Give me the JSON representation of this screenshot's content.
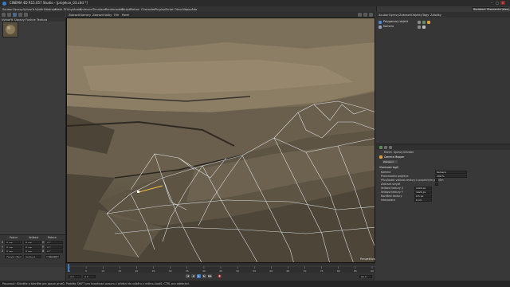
{
  "window": {
    "title": "CINEMA 4D R15.057 Studio - [projekce_03.c4d *]",
    "minimize": "–",
    "maximize": "□",
    "close": "×"
  },
  "menubar": {
    "items": [
      "Soubor",
      "Úpravy",
      "Vytvořit",
      "Výběr",
      "Nástroje",
      "Mesh",
      "Přichytávání",
      "Animace",
      "Simulace",
      "Renderování",
      "Skulpt",
      "Motion",
      "Character",
      "Pluginy",
      "Skript",
      "Okno",
      "Nápověda"
    ]
  },
  "layout": {
    "label_prefix": "Rozložení:",
    "value": "Standardní (start)"
  },
  "material_manager": {
    "tabs": [
      "Vytvořit",
      "Úpravy",
      "Funkce",
      "Textura"
    ]
  },
  "viewport_menu": [
    "Zobrazit",
    "Kamery",
    "Zobrazit",
    "Volby",
    "Filtr",
    "Panel"
  ],
  "viewport": {
    "frame_label": "Perspektiva"
  },
  "coordinates": {
    "headers": [
      "Pozice",
      "Velikost",
      "Rotace"
    ],
    "rows": [
      {
        "axis": "X",
        "pos": "0 cm",
        "size": "0 cm",
        "rot_label": "H",
        "rot": "0 °"
      },
      {
        "axis": "Y",
        "pos": "0 cm",
        "size": "0 cm",
        "rot_label": "P",
        "rot": "0 °"
      },
      {
        "axis": "Z",
        "pos": "0 cm",
        "size": "0 cm",
        "rot_label": "B",
        "rot": "0 °"
      }
    ],
    "mode": "Objekt (Rel)",
    "size_mode": "Velikost",
    "apply": "Použít"
  },
  "object_manager": {
    "menu": [
      "Soubor",
      "Úpravy",
      "Zobrazit",
      "Objekty",
      "Tagy",
      "Záložky"
    ],
    "objects": [
      {
        "name": "Polygonový objekt"
      },
      {
        "name": "Kamera"
      }
    ]
  },
  "attribute_manager": {
    "menu": [
      "Režim",
      "Úpravy",
      "Uživatel"
    ],
    "section_title": "Camera Mapper",
    "tab": "Základní",
    "group": "Vlastnosti tagů",
    "fields": [
      {
        "label": "Kamera",
        "value": "Kamera"
      },
      {
        "label": "Procentuální projekce",
        "value": "100 %"
      },
      {
        "label": "Přizpůsobit velikost textury k projekčním pixelům",
        "value": ""
      },
      {
        "label": "Zobrazit skryté",
        "value": ""
      },
      {
        "label": "Velikost textury X",
        "value": "1024 px"
      },
      {
        "label": "Velikost textury Y",
        "value": "1024 px"
      },
      {
        "label": "Rozlišení textury",
        "value": "0.5 px"
      },
      {
        "label": "Interpolace",
        "value": "0 cm"
      }
    ]
  },
  "timeline": {
    "ticks": [
      "0",
      "5",
      "10",
      "15",
      "20",
      "25",
      "30",
      "35",
      "40",
      "45",
      "50",
      "55",
      "60",
      "65",
      "70",
      "75",
      "80",
      "85",
      "90"
    ],
    "start": "0 F",
    "end": "90 F",
    "current": "0 F"
  },
  "status": {
    "text": "Posunout: Klikněte a táhněte pro posun prvků. Podržte SHIFT pro kvantizaci posunu / přidání do výběru v režimu bodů, CTRL pro odebrání."
  },
  "colors": {
    "accent": "#3c7dc8",
    "mesh_line": "#e6ebf0",
    "selection": "#f0c040"
  }
}
